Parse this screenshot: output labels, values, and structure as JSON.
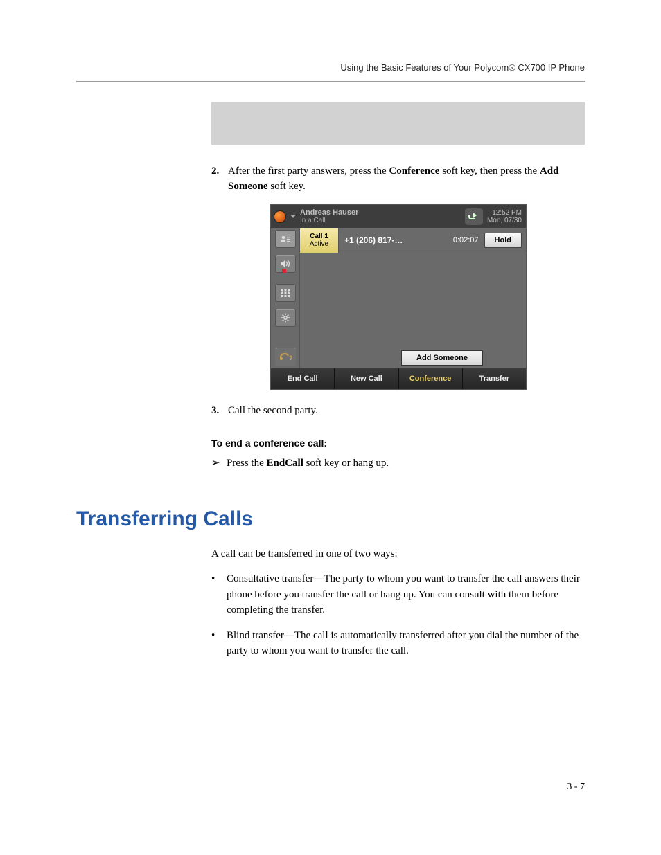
{
  "header": {
    "running_head": "Using the Basic Features of Your Polycom® CX700 IP Phone"
  },
  "steps": {
    "s2_num": "2.",
    "s2_a": "After the first party answers, press the ",
    "s2_b": "Conference",
    "s2_c": " soft key, then press the ",
    "s2_d": "Add Someone",
    "s2_e": " soft key.",
    "s3_num": "3.",
    "s3_text": "Call the second party."
  },
  "phone": {
    "user_name": "Andreas Hauser",
    "status": "In a Call",
    "time": "12:52 PM",
    "date": "Mon, 07/30",
    "call_label": "Call 1",
    "call_state": "Active",
    "number": "+1 (206) 817-…",
    "timer": "0:02:07",
    "hold": "Hold",
    "add_someone": "Add Someone",
    "sk_end": "End Call",
    "sk_new": "New Call",
    "sk_conf": "Conference",
    "sk_transfer": "Transfer"
  },
  "end_conf": {
    "heading": "To end a conference call:",
    "arrow": "➢",
    "line_a": "Press the ",
    "line_b": "EndCall",
    "line_c": " soft key or hang up."
  },
  "section": {
    "title": "Transferring Calls",
    "intro": "A call can be transferred in one of two ways:",
    "b1": "Consultative transfer—The party to whom you want to transfer the call answers their phone before you transfer the call or hang up. You can consult with them before completing the transfer.",
    "b2": "Blind transfer—The call is automatically transferred after you dial the number of the party to whom you want to transfer the call.",
    "bullet_mark": "•"
  },
  "page_number": "3 - 7"
}
